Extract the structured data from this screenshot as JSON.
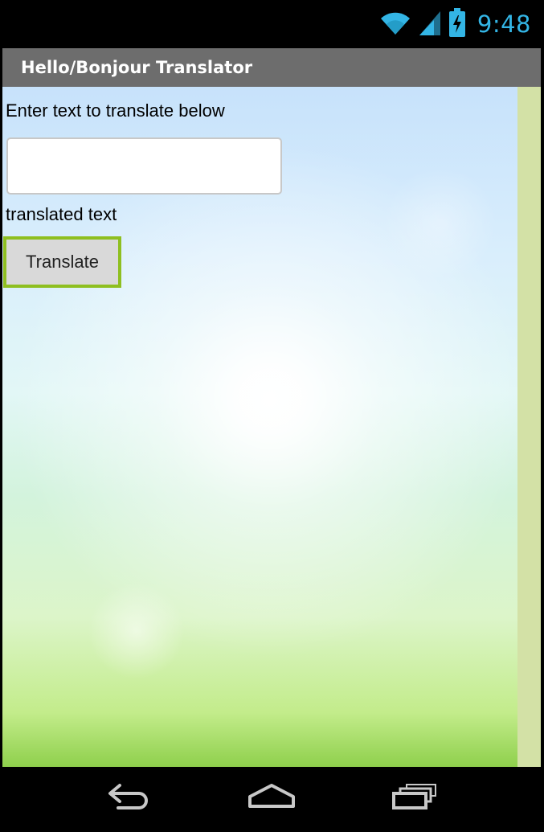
{
  "status_bar": {
    "time": "9:48",
    "icons": [
      "wifi-icon",
      "signal-icon",
      "battery-charging-icon"
    ],
    "accent_color": "#33b5e5"
  },
  "app": {
    "title": "Hello/Bonjour Translator",
    "title_bar_color": "#6d6d6d"
  },
  "form": {
    "prompt_label": "Enter text to translate below",
    "input_value": "",
    "result_label": "translated text",
    "translate_button_label": "Translate",
    "button_border_color": "#8ebf20"
  },
  "nav_bar": {
    "buttons": [
      "back-icon",
      "home-icon",
      "recent-apps-icon"
    ]
  }
}
